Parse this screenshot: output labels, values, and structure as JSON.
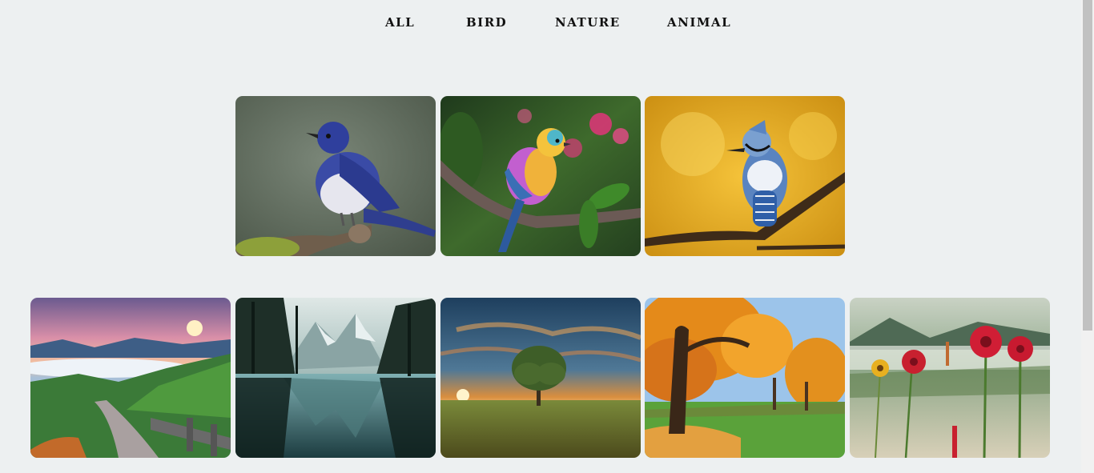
{
  "nav": {
    "items": [
      {
        "label": "ALL"
      },
      {
        "label": "BIRD"
      },
      {
        "label": "NATURE"
      },
      {
        "label": "ANIMAL"
      }
    ]
  },
  "gallery": {
    "bird_row": [
      {
        "subject": "blue-white-flycatcher"
      },
      {
        "subject": "rainbow-bird-on-branch"
      },
      {
        "subject": "blue-jay-on-branch"
      }
    ],
    "nature_row": [
      {
        "subject": "mountain-path-sunset"
      },
      {
        "subject": "mountain-lake-reflection"
      },
      {
        "subject": "lone-tree-field-sunset"
      },
      {
        "subject": "autumn-park-trees"
      },
      {
        "subject": "red-flowers-meadow"
      }
    ]
  },
  "colors": {
    "background": "#edf0f1",
    "nav_text": "#111111"
  }
}
